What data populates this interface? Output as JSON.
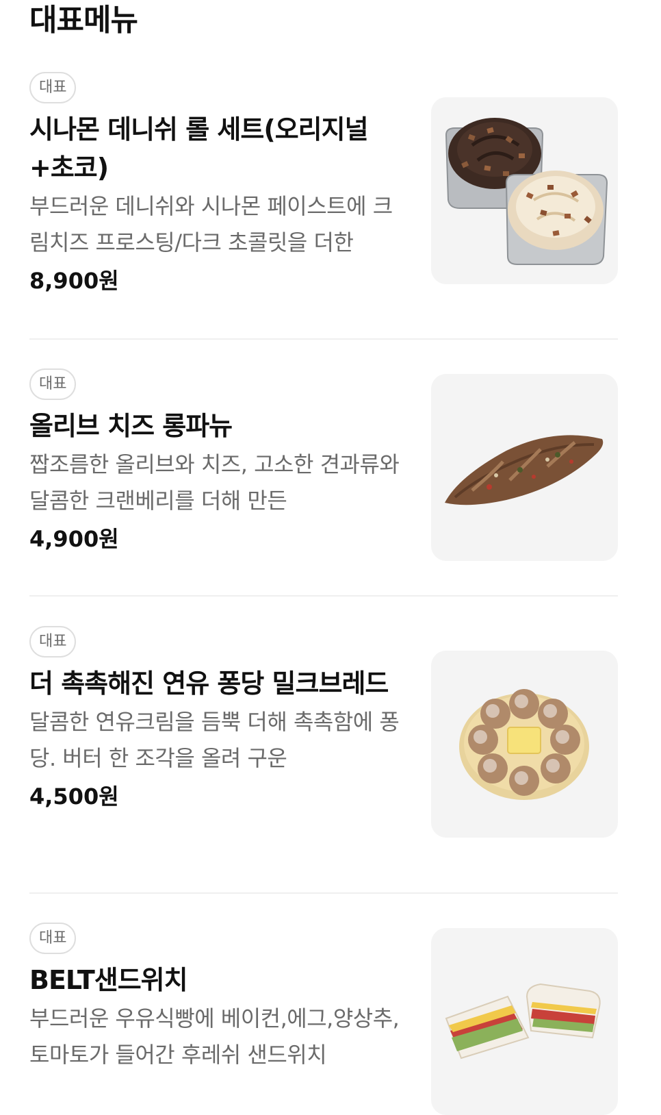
{
  "section": {
    "title": "대표메뉴"
  },
  "items": [
    {
      "badge": "대표",
      "name": "시나몬 데니쉬 롤 세트(오리지널+초코)",
      "description": "부드러운 데니쉬와 시나몬 페이스트에 크림치즈 프로스팅/다크 초콜릿을 더한",
      "price": "8,900원",
      "image_icon": "cinnamon-roll-image"
    },
    {
      "badge": "대표",
      "name": "올리브 치즈 롱파뉴",
      "description": "짭조름한 올리브와 치즈, 고소한 견과류와 달콤한 크랜베리를 더해 만든",
      "price": "4,900원",
      "image_icon": "olive-bread-image"
    },
    {
      "badge": "대표",
      "name": "더 촉촉해진 연유 퐁당 밀크브레드",
      "description": "달콤한 연유크림을 듬뿍 더해 촉촉함에 퐁당. 버터 한 조각을 올려 구운",
      "price": "4,500원",
      "image_icon": "milk-bread-image"
    },
    {
      "badge": "대표",
      "name": "BELT샌드위치",
      "description": "부드러운 우유식빵에 베이컨,에그,양상추,토마토가 들어간 후레쉬 샌드위치",
      "price": "",
      "image_icon": "sandwich-image"
    }
  ]
}
